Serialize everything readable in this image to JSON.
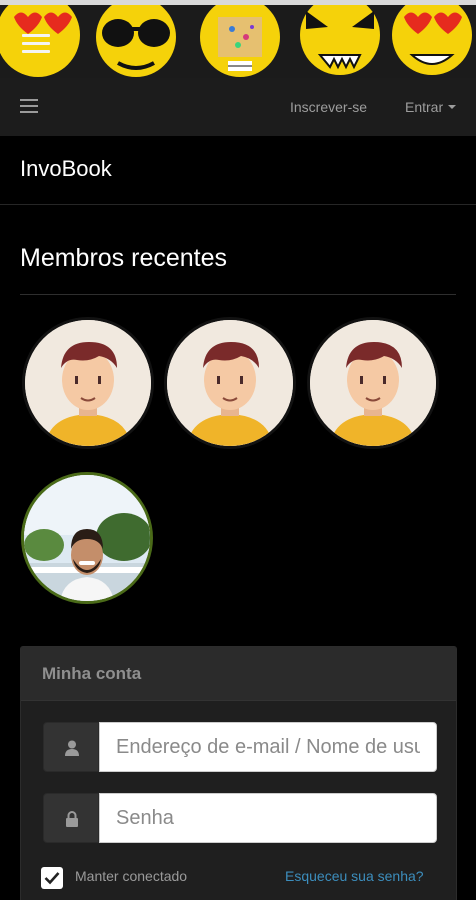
{
  "navbar": {
    "signup_label": "Inscrever-se",
    "login_label": "Entrar"
  },
  "site": {
    "title": "InvoBook"
  },
  "recent_members": {
    "title": "Membros recentes"
  },
  "account": {
    "title": "Minha conta",
    "username_placeholder": "Endereço de e-mail / Nome de usuário",
    "password_placeholder": "Senha",
    "remember_label": "Manter conectado",
    "forgot_label": "Esqueceu sua senha?"
  },
  "icons": {
    "banner_menu": "hamburger-icon",
    "nav_toggle": "hamburger-icon",
    "login_caret": "caret-down-icon",
    "username": "user-icon",
    "password": "lock-icon",
    "remember_check": "checkmark-icon"
  },
  "colors": {
    "background": "#000000",
    "navbar": "#1c1c1c",
    "panel": "#1f1f1f",
    "panel_heading": "#2b2b2b",
    "link": "#3c8dbc",
    "emoji_yellow": "#f5d20a"
  }
}
